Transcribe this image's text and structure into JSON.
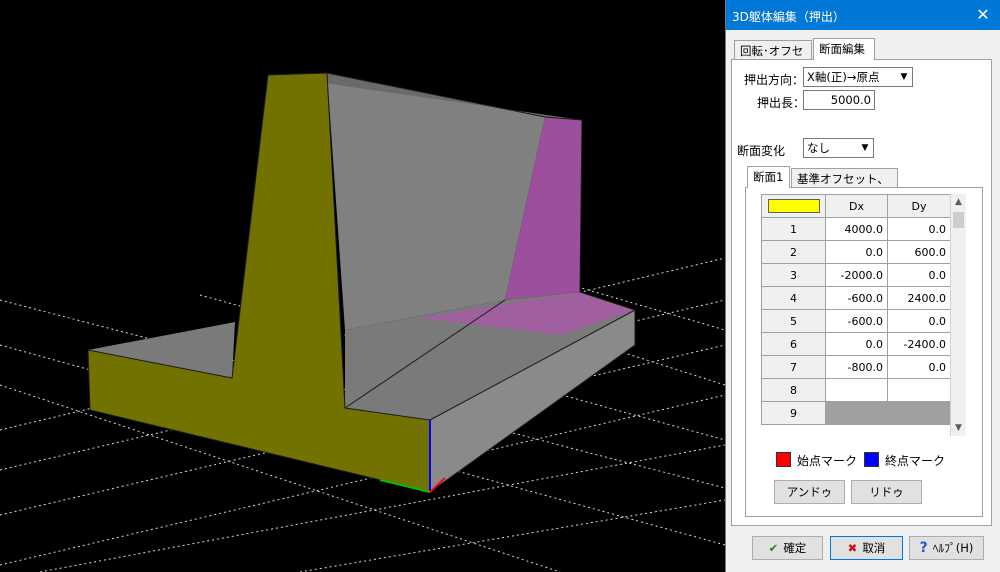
{
  "dialog": {
    "title": "3D躯体編集（押出）",
    "close_symbol": "✕",
    "tabs": [
      "回転･オフセット",
      "断面編集"
    ],
    "extrude_direction_label": "押出方向：",
    "extrude_direction_value": "X軸(正)→原点",
    "extrude_length_label": "押出長：",
    "extrude_length_value": "5000.0",
    "section_change_label": "断面変化",
    "section_change_value": "なし",
    "subtabs": [
      "断面1",
      "基準オフセット、角度"
    ],
    "grid": {
      "header_color": "#ffff00",
      "columns": [
        "Dx",
        "Dy"
      ],
      "rows": [
        {
          "no": "1",
          "dx": "4000.0",
          "dy": "0.0"
        },
        {
          "no": "2",
          "dx": "0.0",
          "dy": "600.0"
        },
        {
          "no": "3",
          "dx": "-2000.0",
          "dy": "0.0"
        },
        {
          "no": "4",
          "dx": "-600.0",
          "dy": "2400.0"
        },
        {
          "no": "5",
          "dx": "-600.0",
          "dy": "0.0"
        },
        {
          "no": "6",
          "dx": "0.0",
          "dy": "-2400.0"
        },
        {
          "no": "7",
          "dx": "-800.0",
          "dy": "0.0"
        },
        {
          "no": "8",
          "dx": "",
          "dy": ""
        },
        {
          "no": "9",
          "dx": "",
          "dy": ""
        }
      ]
    },
    "start_mark_label": "始点マーク",
    "start_mark_color": "#ff0000",
    "end_mark_label": "終点マーク",
    "end_mark_color": "#0000ff",
    "undo_label": "アンドゥ",
    "redo_label": "リドゥ",
    "ok_label": "確定",
    "cancel_label": "取消",
    "help_label": "ﾍﾙﾌﾟ(H)"
  },
  "viewport": {
    "background": "#000000",
    "face_colors": {
      "front": "#727200",
      "side": "#9c4f9c",
      "gray": "#808080"
    }
  }
}
